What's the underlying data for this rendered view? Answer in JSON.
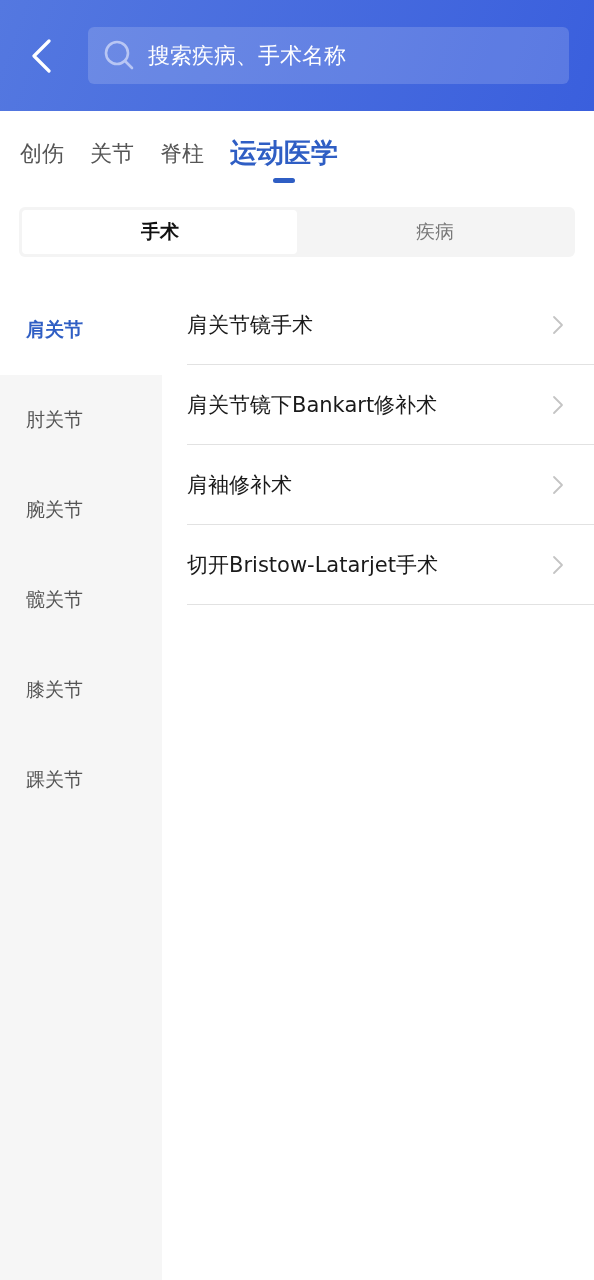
{
  "search": {
    "placeholder": "搜索疾病、手术名称"
  },
  "tabs": [
    {
      "label": "创伤",
      "selected": false
    },
    {
      "label": "关节",
      "selected": false
    },
    {
      "label": "脊柱",
      "selected": false
    },
    {
      "label": "运动医学",
      "selected": true
    }
  ],
  "segments": [
    {
      "label": "手术",
      "selected": true
    },
    {
      "label": "疾病",
      "selected": false
    }
  ],
  "sidebar": {
    "items": [
      {
        "label": "肩关节",
        "selected": true
      },
      {
        "label": "肘关节",
        "selected": false
      },
      {
        "label": "腕关节",
        "selected": false
      },
      {
        "label": "髋关节",
        "selected": false
      },
      {
        "label": "膝关节",
        "selected": false
      },
      {
        "label": "踝关节",
        "selected": false
      }
    ]
  },
  "list": {
    "items": [
      {
        "label": "肩关节镜手术"
      },
      {
        "label": "肩关节镜下Bankart修补术"
      },
      {
        "label": "肩袖修补术"
      },
      {
        "label": "切开Bristow-Latarjet手术"
      }
    ]
  }
}
